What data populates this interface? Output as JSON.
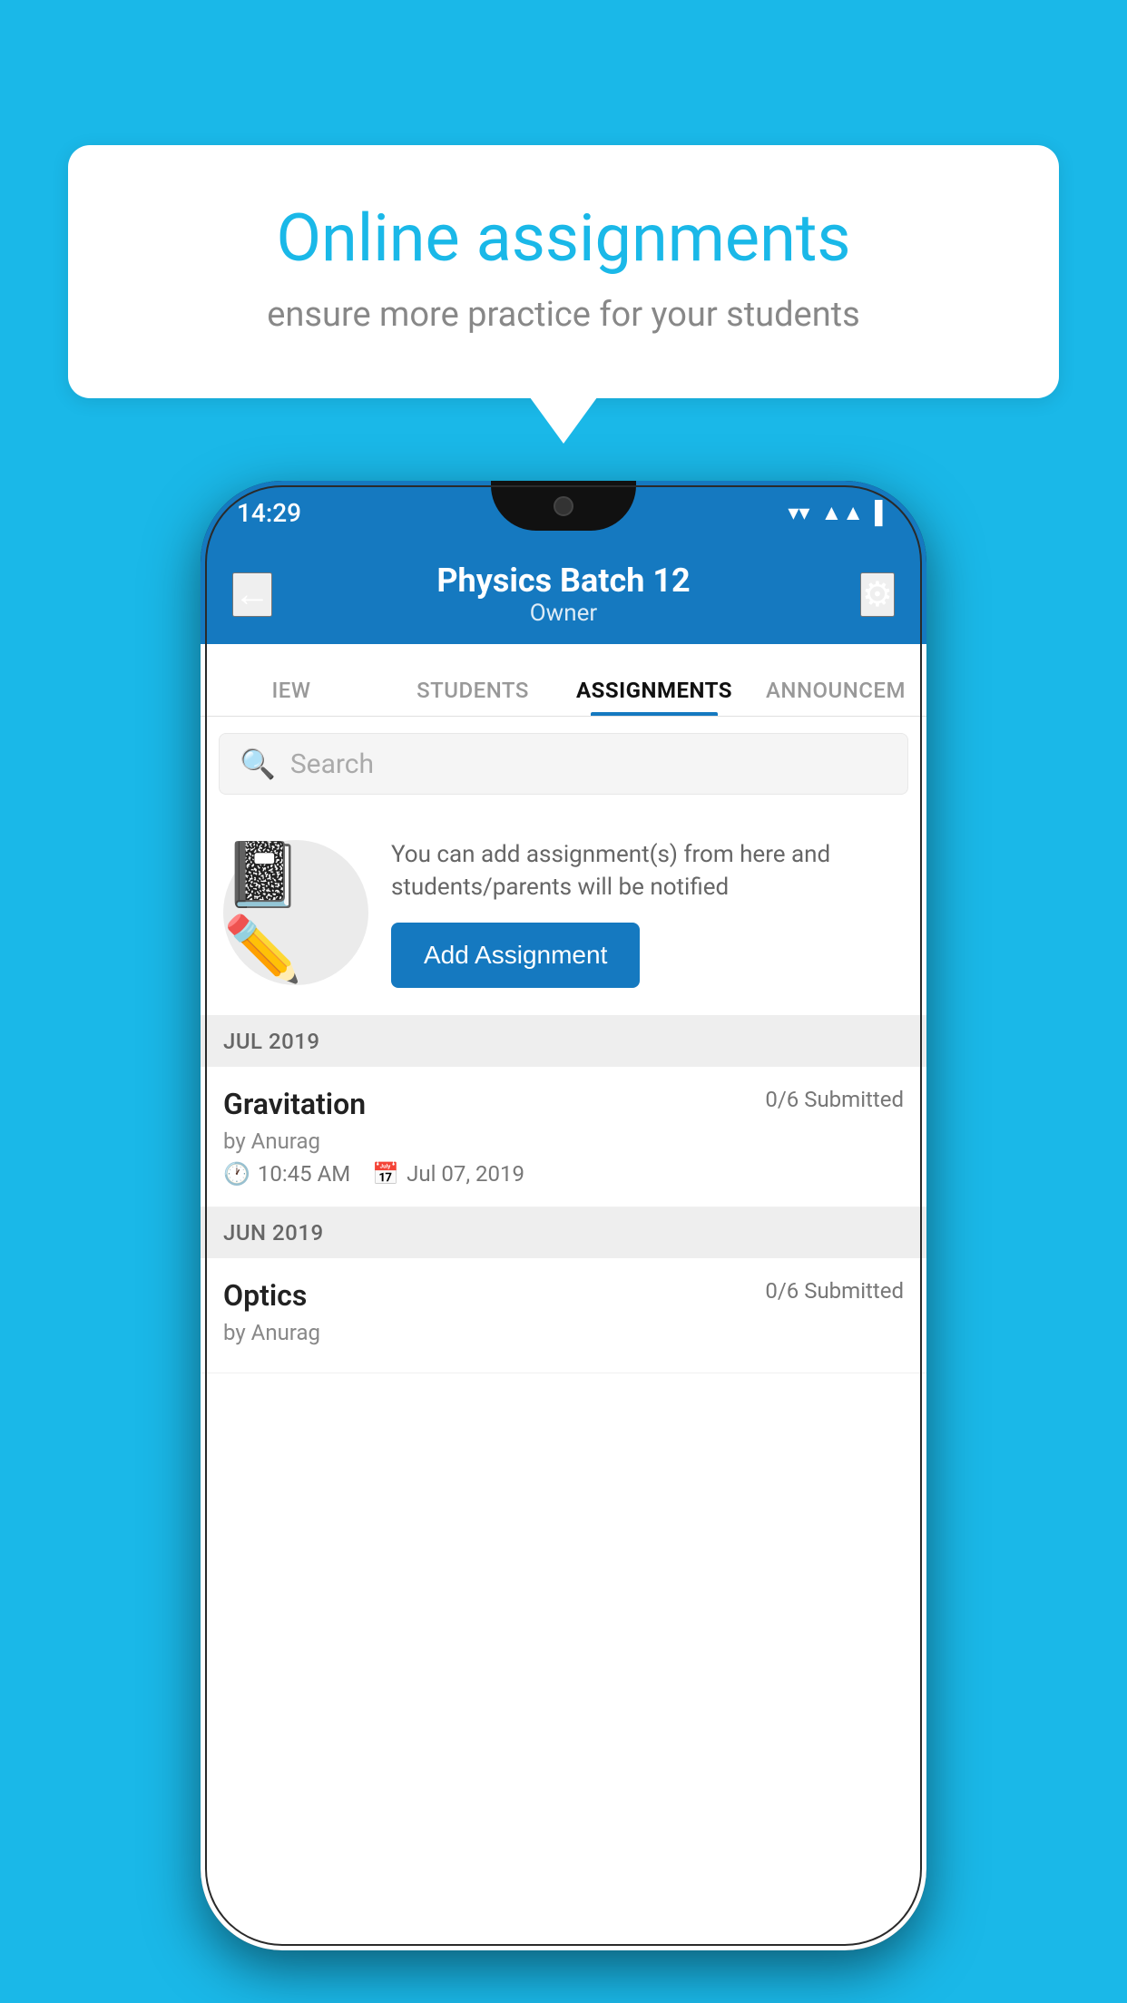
{
  "background": {
    "color": "#1ab8e8"
  },
  "speech_bubble": {
    "title": "Online assignments",
    "subtitle": "ensure more practice for your students"
  },
  "phone": {
    "status_bar": {
      "time": "14:29",
      "wifi_icon": "▼",
      "signal_icon": "▲",
      "battery_icon": "▌"
    },
    "header": {
      "back_label": "←",
      "title": "Physics Batch 12",
      "subtitle": "Owner",
      "settings_icon": "⚙"
    },
    "tabs": [
      {
        "label": "IEW",
        "active": false
      },
      {
        "label": "STUDENTS",
        "active": false
      },
      {
        "label": "ASSIGNMENTS",
        "active": true
      },
      {
        "label": "ANNOUNCEM",
        "active": false
      }
    ],
    "search": {
      "placeholder": "Search"
    },
    "promo": {
      "icon": "📓",
      "description": "You can add assignment(s) from here and students/parents will be notified",
      "add_button_label": "Add Assignment"
    },
    "sections": [
      {
        "label": "JUL 2019",
        "assignments": [
          {
            "name": "Gravitation",
            "submitted": "0/6 Submitted",
            "author": "by Anurag",
            "time": "10:45 AM",
            "date": "Jul 07, 2019"
          }
        ]
      },
      {
        "label": "JUN 2019",
        "assignments": [
          {
            "name": "Optics",
            "submitted": "0/6 Submitted",
            "author": "by Anurag",
            "time": "",
            "date": ""
          }
        ]
      }
    ]
  }
}
